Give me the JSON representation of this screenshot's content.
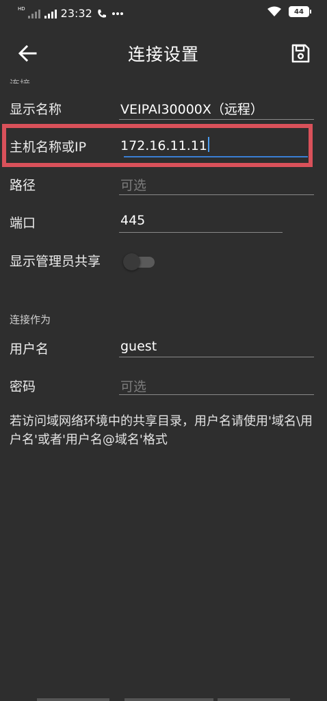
{
  "status_bar": {
    "time": "23:32",
    "net1": "HD",
    "net2": "4G HD",
    "extra_icons": [
      "phone-wifi-call-icon",
      "more-dots-icon"
    ],
    "battery": "44"
  },
  "app_bar": {
    "title": "连接设置",
    "back_icon": "arrow-back-icon",
    "save_icon": "save-floppy-icon"
  },
  "form": {
    "cut_off_label": "连接",
    "display_name": {
      "label": "显示名称",
      "value": "VEIPAI30000X（远程）"
    },
    "host": {
      "label": "主机名称或IP",
      "value": "172.16.11.11"
    },
    "path": {
      "label": "路径",
      "placeholder": "可选"
    },
    "port": {
      "label": "端口",
      "value": "445"
    },
    "show_admin_shares": {
      "label": "显示管理员共享",
      "enabled": false
    }
  },
  "connect_as": {
    "header": "连接作为",
    "username": {
      "label": "用户名",
      "value": "guest"
    },
    "password": {
      "label": "密码",
      "placeholder": "可选"
    },
    "hint": "若访问域网络环境中的共享目录，用户名请使用'域名\\用户名'或者'用户名@域名'格式"
  },
  "colors": {
    "background": "#2e2e2e",
    "highlight": "#d9515a",
    "focus_underline": "#3a7fd5"
  }
}
